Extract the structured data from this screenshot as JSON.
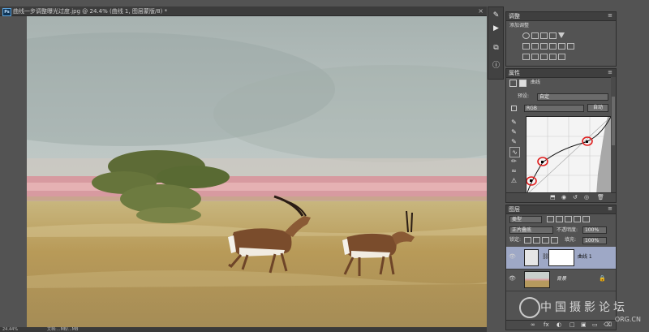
{
  "document": {
    "tab_badge": "Ps",
    "title": "曲线一步调整曝光过度.jpg @ 24.4% (曲线 1, 图层蒙版/8) *",
    "close": "×"
  },
  "status": {
    "zoom": "24.44%",
    "doc": "文档:...MB/...MB"
  },
  "icon_strip": [
    {
      "name": "history-icon",
      "glyph": "✎"
    },
    {
      "name": "play-action-icon",
      "glyph": "▶"
    },
    {
      "name": "layers-comp-icon",
      "glyph": "⧉"
    },
    {
      "name": "info-icon",
      "glyph": "ⓘ"
    }
  ],
  "adjustments": {
    "tab": "调整",
    "menu": "≡",
    "subtitle": "添加调整"
  },
  "properties": {
    "tab": "属性",
    "menu": "≡",
    "panel_title": "曲线",
    "preset_label": "预设:",
    "preset_value": "自定",
    "channel_value": "RGB",
    "auto_button": "自动"
  },
  "layers": {
    "tab": "图层",
    "menu": "≡",
    "filter_value": "类型",
    "blend_value": "正片叠底",
    "opacity_label": "不透明度:",
    "opacity_value": "100%",
    "lock_label": "锁定:",
    "fill_label": "填充:",
    "fill_value": "100%",
    "items": [
      {
        "name": "曲线 1",
        "selected": true
      },
      {
        "name": "背景",
        "selected": false
      }
    ],
    "bottom_icons": [
      "fx",
      "◐",
      "□",
      "▣",
      "▭",
      "⌫"
    ]
  },
  "watermark": {
    "text": "中国摄影论坛",
    "url": "ORG.CN"
  },
  "colors": {
    "curve_selected_bg": "#9ea8c6",
    "annotation_red": "#e02020"
  }
}
